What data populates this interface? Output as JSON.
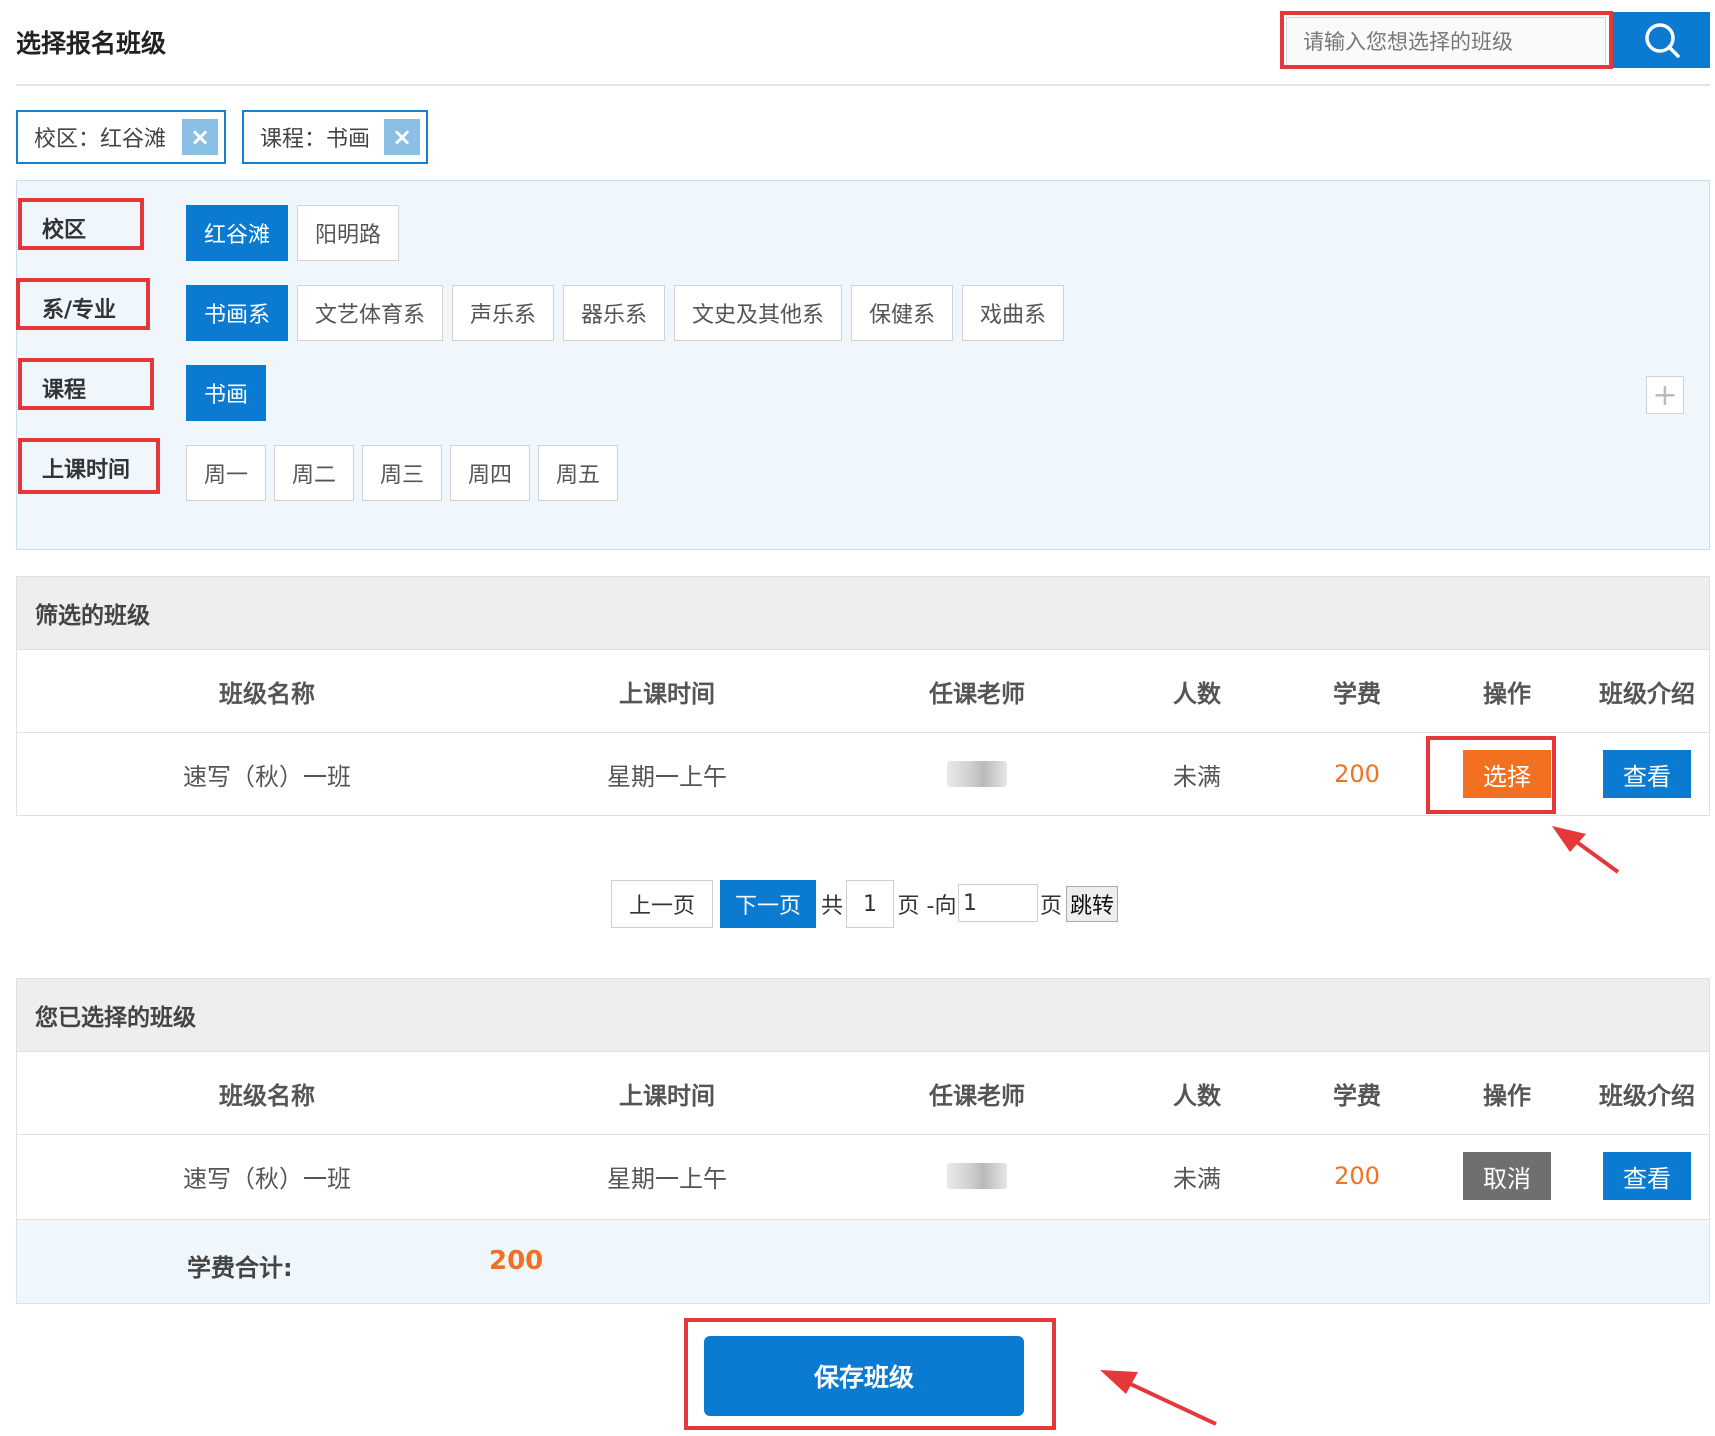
{
  "header": {
    "title": "选择报名班级",
    "search_placeholder": "请输入您想选择的班级"
  },
  "selected_filters": [
    {
      "label": "校区：红谷滩"
    },
    {
      "label": "课程：书画"
    }
  ],
  "filter_remove_symbol": "×",
  "filters": {
    "campus": {
      "label": "校区",
      "options": [
        "红谷滩",
        "阳明路"
      ],
      "active": "红谷滩"
    },
    "department": {
      "label": "系/专业",
      "options": [
        "书画系",
        "文艺体育系",
        "声乐系",
        "器乐系",
        "文史及其他系",
        "保健系",
        "戏曲系"
      ],
      "active": "书画系"
    },
    "course": {
      "label": "课程",
      "options": [
        "书画"
      ],
      "active": "书画"
    },
    "schedule": {
      "label": "上课时间",
      "options": [
        "周一",
        "周二",
        "周三",
        "周四",
        "周五"
      ],
      "active": ""
    }
  },
  "expand_symbol": "+",
  "filtered": {
    "title": "筛选的班级",
    "columns": [
      "班级名称",
      "上课时间",
      "任课老师",
      "人数",
      "学费",
      "操作",
      "班级介绍"
    ],
    "rows": [
      {
        "name": "速写（秋）一班",
        "time": "星期一上午",
        "count": "未满",
        "fee": "200",
        "action": "选择",
        "detail": "查看"
      }
    ]
  },
  "pagination": {
    "prev": "上一页",
    "next": "下一页",
    "total_prefix": "共",
    "total_pages": "1",
    "goto_text": "页 -向",
    "goto_value": "1",
    "goto_suffix": "页",
    "jump": "跳转"
  },
  "chosen": {
    "title": "您已选择的班级",
    "columns": [
      "班级名称",
      "上课时间",
      "任课老师",
      "人数",
      "学费",
      "操作",
      "班级介绍"
    ],
    "rows": [
      {
        "name": "速写（秋）一班",
        "time": "星期一上午",
        "count": "未满",
        "fee": "200",
        "action": "取消",
        "detail": "查看"
      }
    ],
    "total_label": "学费合计:",
    "total_value": "200"
  },
  "save_label": "保存班级",
  "colors": {
    "primary": "#0b7ad1",
    "accent_orange": "#f37021",
    "highlight_red": "#e5383b"
  }
}
